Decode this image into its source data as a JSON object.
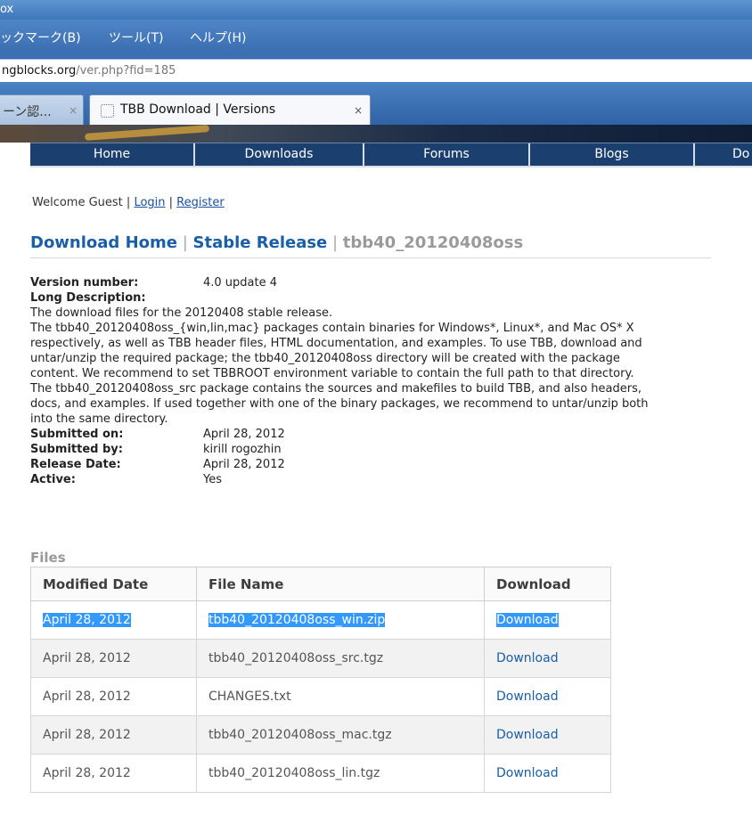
{
  "browser": {
    "title_fragment": "ox",
    "menu": [
      "ックマーク(B)",
      "ツール(T)",
      "ヘルプ(H)"
    ],
    "url_host": "ngblocks.org",
    "url_path": "/ver.php?fid=185",
    "tabs": [
      {
        "label": "ーン認...",
        "close": "×"
      },
      {
        "label": "TBB Download | Versions",
        "close": "×"
      }
    ]
  },
  "site_nav": [
    "Home",
    "Downloads",
    "Forums",
    "Blogs",
    "Do"
  ],
  "welcome": {
    "prefix": "Welcome Guest | ",
    "login": "Login",
    "sep": " | ",
    "register": "Register"
  },
  "breadcrumb": {
    "home": "Download Home",
    "sep1": " | ",
    "stable": "Stable Release",
    "sep2": " | ",
    "current": "tbb40_20120408oss"
  },
  "details": {
    "version_label": "Version number:",
    "version_value": "4.0 update 4",
    "long_desc_label": "Long Description:",
    "description_lines": [
      "The download files for the 20120408 stable release.",
      "The tbb40_20120408oss_{win,lin,mac} packages contain binaries for Windows*, Linux*, and Mac OS* X",
      "respectively, as well as TBB header files, HTML documentation, and examples. To use TBB, download and",
      "untar/unzip the required package; the tbb40_20120408oss directory will be created with the package",
      "content. We recommend to set TBBROOT environment variable to contain the full path to that directory.",
      "The tbb40_20120408oss_src package contains the sources and makefiles to build TBB, and also headers,",
      "docs, and examples. If used together with one of the binary packages, we recommend to untar/unzip both",
      "into the same directory."
    ],
    "submitted_on_label": "Submitted on:",
    "submitted_on_value": "April 28, 2012",
    "submitted_by_label": "Submitted by:",
    "submitted_by_value": "kirill rogozhin",
    "release_date_label": "Release Date:",
    "release_date_value": "April 28, 2012",
    "active_label": "Active:",
    "active_value": "Yes"
  },
  "files": {
    "heading": "Files",
    "columns": [
      "Modified Date",
      "File Name",
      "Download"
    ],
    "rows": [
      {
        "date": "April 28, 2012",
        "name": "tbb40_20120408oss_win.zip",
        "download": "Download"
      },
      {
        "date": "April 28, 2012",
        "name": "tbb40_20120408oss_src.tgz",
        "download": "Download"
      },
      {
        "date": "April 28, 2012",
        "name": "CHANGES.txt",
        "download": "Download"
      },
      {
        "date": "April 28, 2012",
        "name": "tbb40_20120408oss_mac.tgz",
        "download": "Download"
      },
      {
        "date": "April 28, 2012",
        "name": "tbb40_20120408oss_lin.tgz",
        "download": "Download"
      }
    ]
  }
}
